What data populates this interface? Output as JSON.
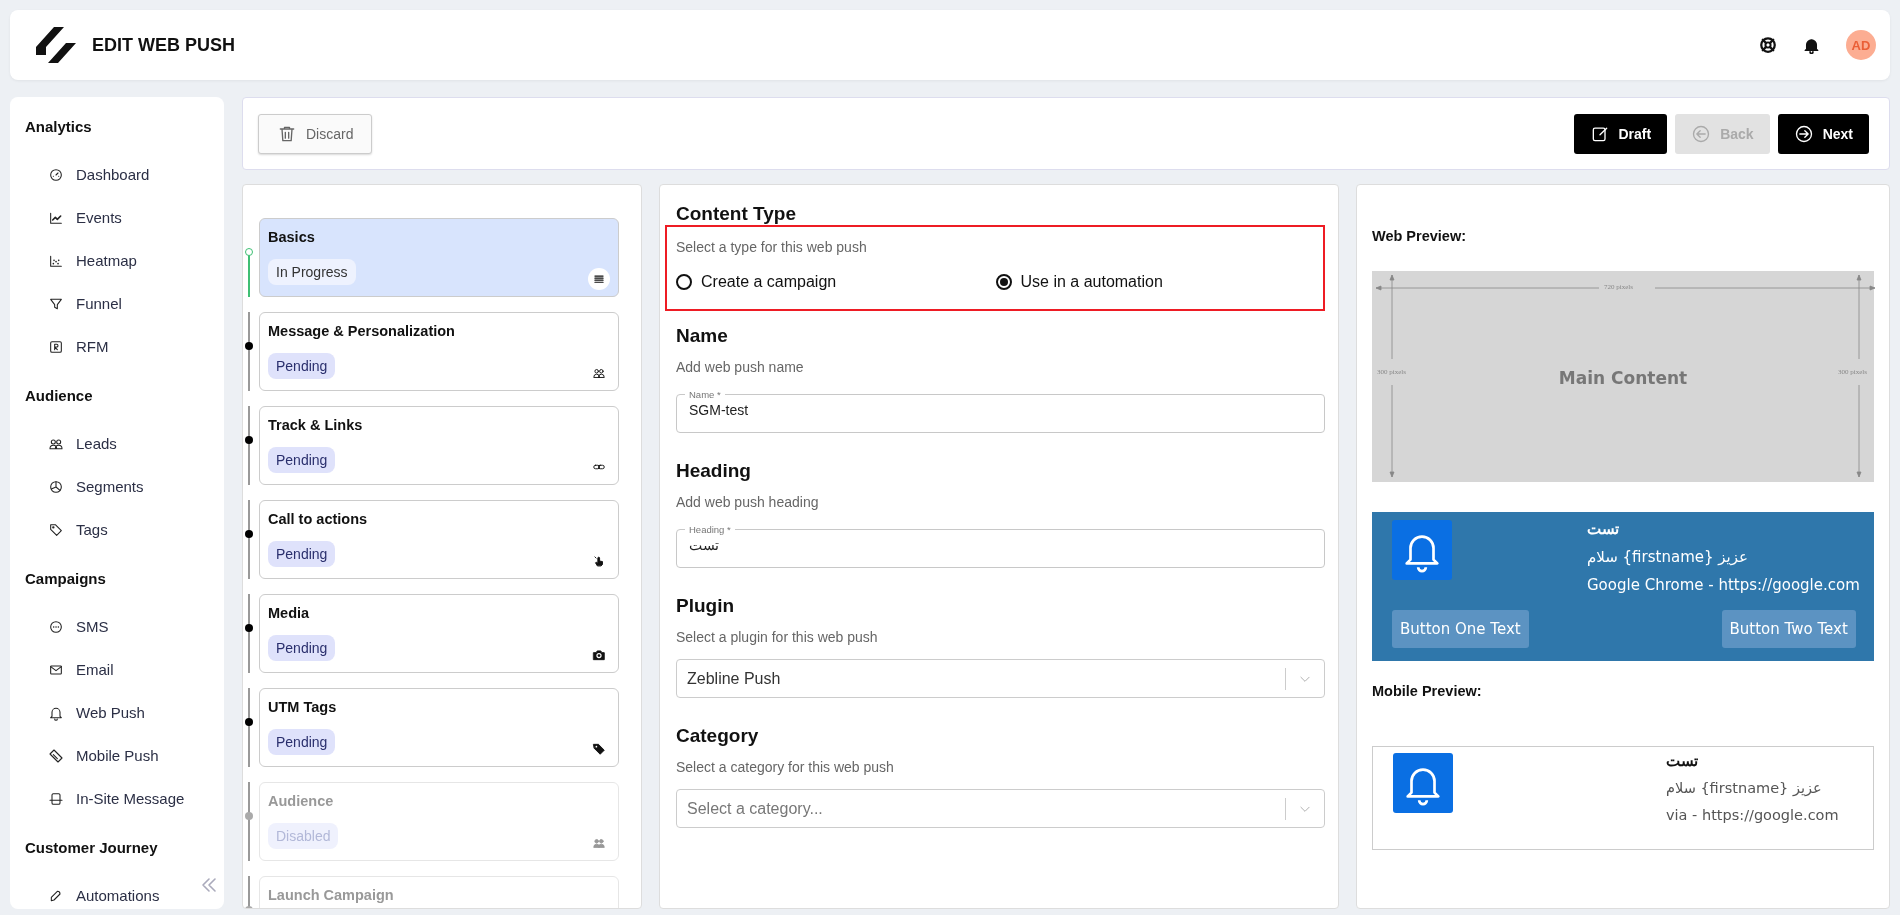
{
  "header": {
    "title": "EDIT WEB PUSH",
    "avatar": "AD"
  },
  "sidebar": {
    "sections": [
      {
        "title": "Analytics",
        "items": [
          "Dashboard",
          "Events",
          "Heatmap",
          "Funnel",
          "RFM"
        ]
      },
      {
        "title": "Audience",
        "items": [
          "Leads",
          "Segments",
          "Tags"
        ]
      },
      {
        "title": "Campaigns",
        "items": [
          "SMS",
          "Email",
          "Web Push",
          "Mobile Push",
          "In-Site Message"
        ]
      },
      {
        "title": "Customer Journey",
        "items": [
          "Automations"
        ]
      }
    ]
  },
  "toolbar": {
    "buttons": [
      {
        "label": "Discard",
        "kind": "secondary",
        "disabled": false
      },
      {
        "label": "Draft",
        "kind": "primary",
        "disabled": false
      },
      {
        "label": "Back",
        "kind": "primary",
        "disabled": true
      },
      {
        "label": "Next",
        "kind": "primary",
        "disabled": false
      }
    ]
  },
  "steps": [
    {
      "title": "Basics",
      "status": "In Progress",
      "selected": true,
      "disabled": false
    },
    {
      "title": "Message & Personalization",
      "status": "Pending",
      "selected": false,
      "disabled": false
    },
    {
      "title": "Track & Links",
      "status": "Pending",
      "selected": false,
      "disabled": false
    },
    {
      "title": "Call to actions",
      "status": "Pending",
      "selected": false,
      "disabled": false
    },
    {
      "title": "Media",
      "status": "Pending",
      "selected": false,
      "disabled": false
    },
    {
      "title": "UTM Tags",
      "status": "Pending",
      "selected": false,
      "disabled": false
    },
    {
      "title": "Audience",
      "status": "Disabled",
      "selected": false,
      "disabled": true
    },
    {
      "title": "Launch Campaign",
      "selected": false,
      "disabled": true
    }
  ],
  "form": {
    "content_type": {
      "heading": "Content Type",
      "hint": "Select a type for this web push",
      "highlighted": true,
      "options": [
        {
          "label": "Create a campaign",
          "selected": false
        },
        {
          "label": "Use in a automation",
          "selected": true
        }
      ]
    },
    "name": {
      "heading": "Name",
      "hint": "Add web push name",
      "field_label": "Name *",
      "value": "SGM-test"
    },
    "heading": {
      "heading": "Heading",
      "hint": "Add web push heading",
      "field_label": "Heading *",
      "value": "تست"
    },
    "plugin": {
      "heading": "Plugin",
      "hint": "Select a plugin for this web push",
      "value": "Zebline Push"
    },
    "category": {
      "heading": "Category",
      "hint": "Select a category for this web push",
      "placeholder": "Select a category..."
    }
  },
  "web_preview": {
    "title": "Web Preview:",
    "diagram": {
      "width_label": "720 pixels",
      "left_label": "300 pixels",
      "right_label": "300 pixels",
      "caption": "Main Content"
    },
    "notification": {
      "title": "تست",
      "message": "سلام {firstname} عزیز",
      "source": "Google Chrome - https://google.com",
      "buttons": [
        "Button One Text",
        "Button Two Text"
      ]
    }
  },
  "mobile_preview": {
    "title": "Mobile Preview:",
    "notification": {
      "title": "تست",
      "message": "سلام {firstname} عزیز",
      "source": "via - https://google.com"
    }
  }
}
